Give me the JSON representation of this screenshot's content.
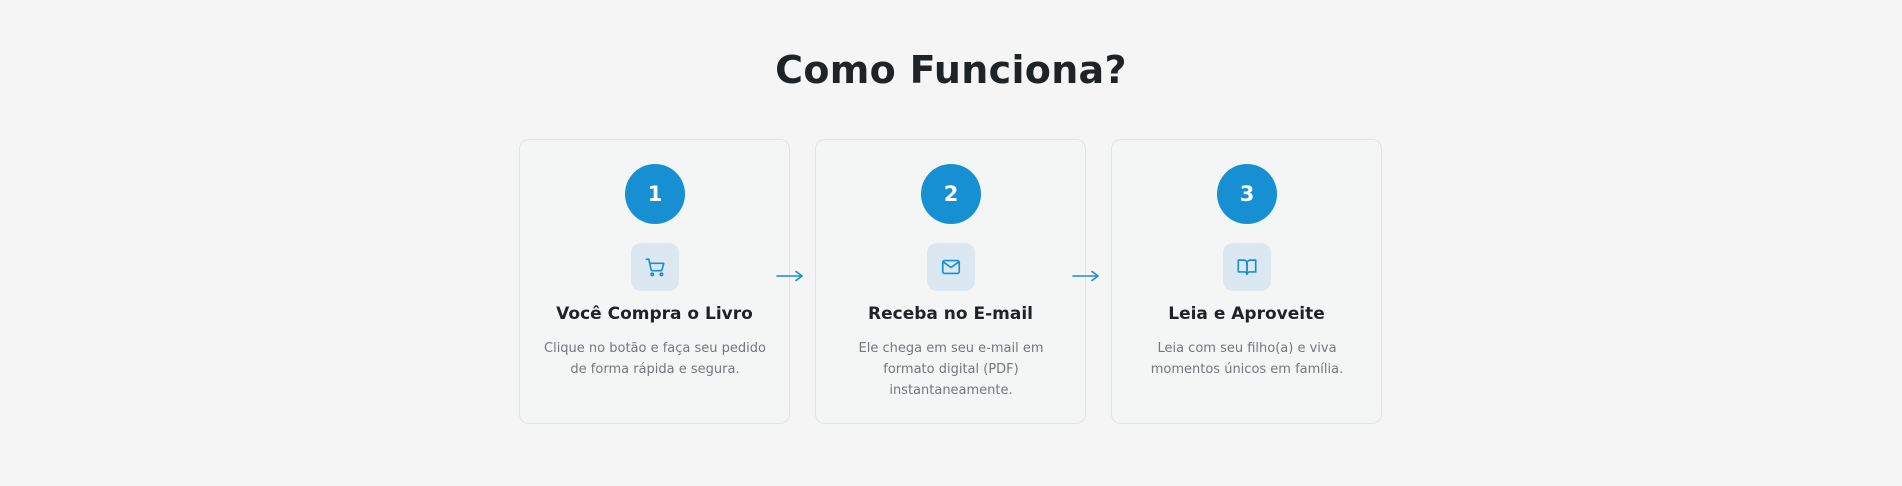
{
  "section": {
    "title": "Como Funciona?"
  },
  "steps": [
    {
      "number": "1",
      "icon": "shopping-cart-icon",
      "title": "Você Compra o Livro",
      "description": "Clique no botão e faça seu pedido de forma rápida e segura."
    },
    {
      "number": "2",
      "icon": "mail-icon",
      "title": "Receba no E-mail",
      "description": "Ele chega em seu e-mail em formato digital (PDF) instantaneamente."
    },
    {
      "number": "3",
      "icon": "open-book-icon",
      "title": "Leia e Aproveite",
      "description": "Leia com seu filho(a) e viva momentos únicos em família."
    }
  ],
  "colors": {
    "background": "#f4f5f4",
    "accent": "#1690d2",
    "icon_bg": "#dce8f1",
    "title_text": "#1f2326",
    "body_text": "#73787d",
    "card_border": "#e1e4e6"
  }
}
